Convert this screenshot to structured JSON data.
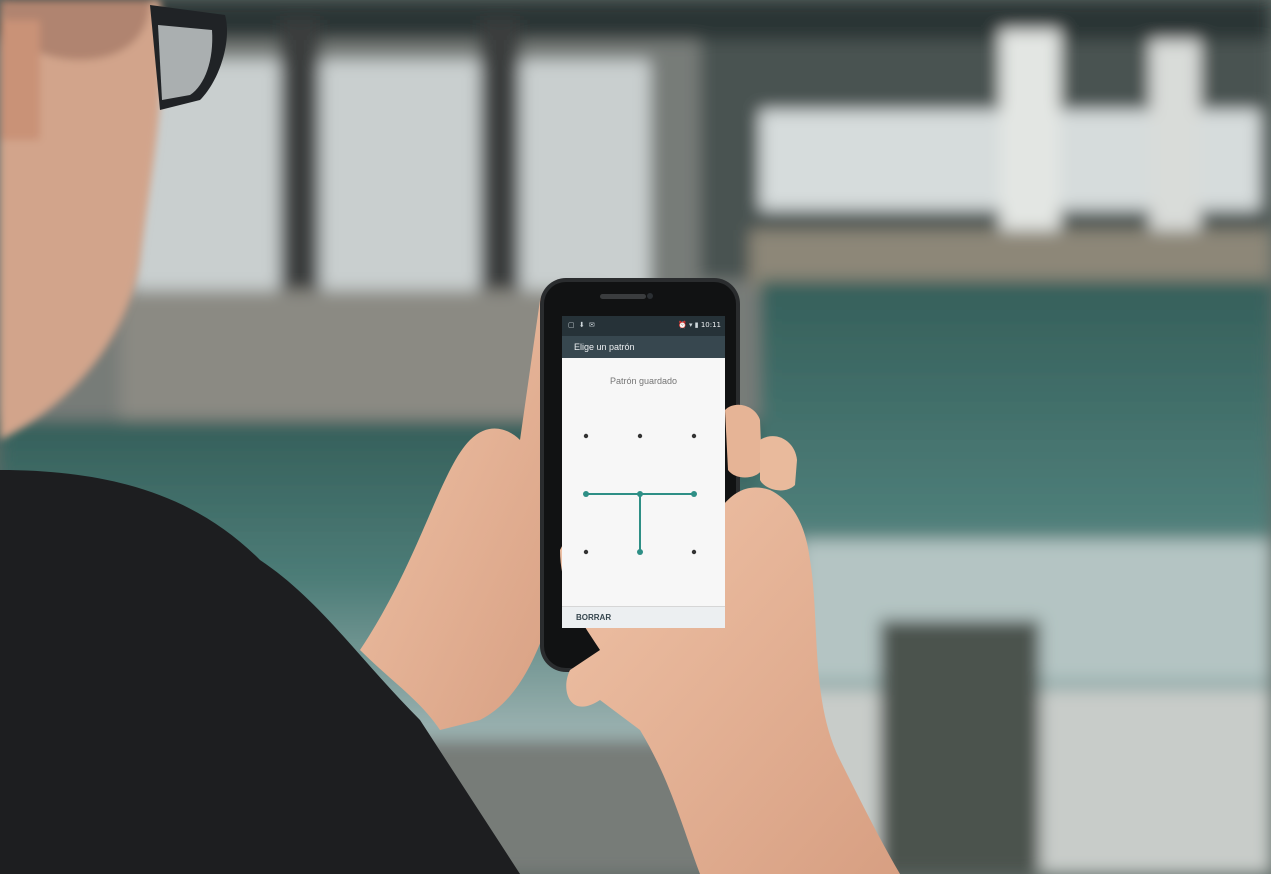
{
  "phone": {
    "status_bar": {
      "time": "10:11",
      "left_icons": [
        "notification-icon",
        "download-icon",
        "message-icon"
      ],
      "right_icons": [
        "alarm-icon",
        "wifi-icon",
        "network-icon",
        "battery-icon"
      ]
    },
    "app_bar": {
      "title": "Elige un patrón"
    },
    "pattern": {
      "status_text": "Patrón guardado",
      "grid_size": 3,
      "selected_sequence": [
        7,
        4,
        5,
        3
      ],
      "line_color": "#2e8f86",
      "dot_color": "#333333"
    },
    "bottom_bar": {
      "erase_label": "BORRAR"
    }
  },
  "colors": {
    "water": "#3f6f6a",
    "shirt": "#1e1f21",
    "skin": "#e8b69a"
  }
}
